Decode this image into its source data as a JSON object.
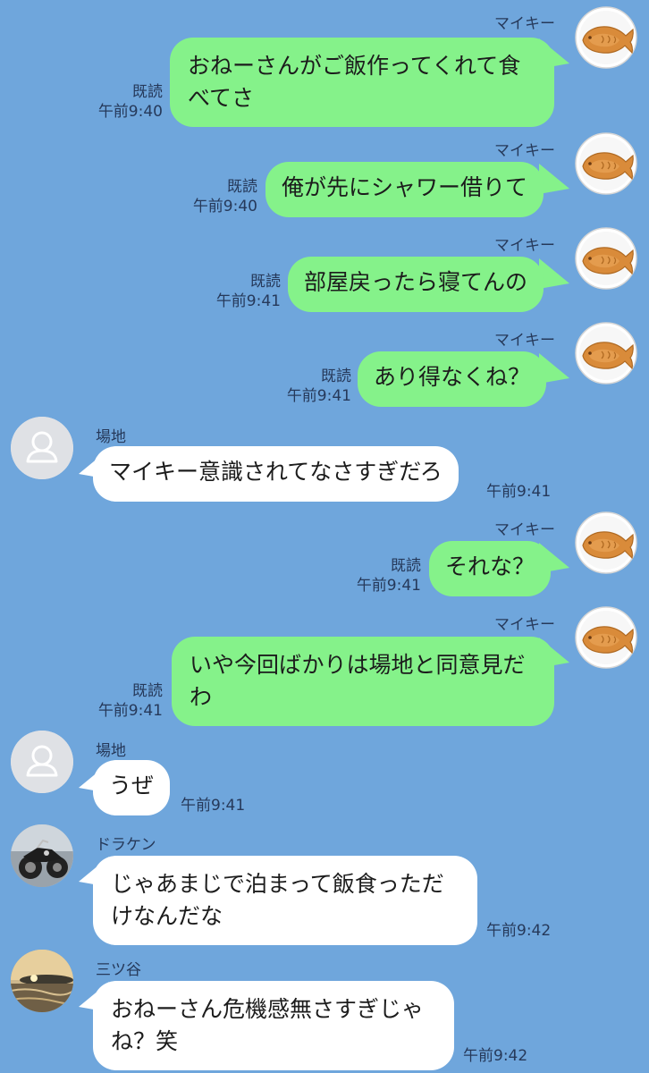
{
  "messages": [
    {
      "sender": "マイキー",
      "text": "おねーさんがご飯作ってくれて食\nべてさ",
      "read": "既読",
      "time": "午前9:40"
    },
    {
      "sender": "マイキー",
      "text": "俺が先にシャワー借りて",
      "read": "既読",
      "time": "午前9:40"
    },
    {
      "sender": "マイキー",
      "text": "部屋戻ったら寝てんの",
      "read": "既読",
      "time": "午前9:41"
    },
    {
      "sender": "マイキー",
      "text": "あり得なくね？",
      "read": "既読",
      "time": "午前9:41"
    },
    {
      "sender": "場地",
      "text": "マイキー意識されてなさすぎだろ",
      "time": "午前9:41"
    },
    {
      "sender": "マイキー",
      "text": "それな？",
      "read": "既読",
      "time": "午前9:41"
    },
    {
      "sender": "マイキー",
      "text": "いや今回ばかりは場地と同意見だ\nわ",
      "read": "既読",
      "time": "午前9:41"
    },
    {
      "sender": "場地",
      "text": "うぜ",
      "time": "午前9:41"
    },
    {
      "sender": "ドラケン",
      "text": "じゃあまじで泊まって飯食っただ\nけなんだな",
      "time": "午前9:42"
    },
    {
      "sender": "三ツ谷",
      "text": "おねーさん危機感無さすぎじゃ\nね？笑",
      "time": "午前9:42"
    }
  ],
  "icons": {
    "mikey_avatar": "taiyaki-avatar-icon",
    "baji_avatar": "default-user-icon",
    "draken_avatar": "motorcycle-photo-avatar",
    "mitsuya_avatar": "sunset-photo-avatar"
  },
  "colors": {
    "background": "#6fa6dc",
    "own_bubble": "#85f28a",
    "other_bubble": "#ffffff"
  }
}
